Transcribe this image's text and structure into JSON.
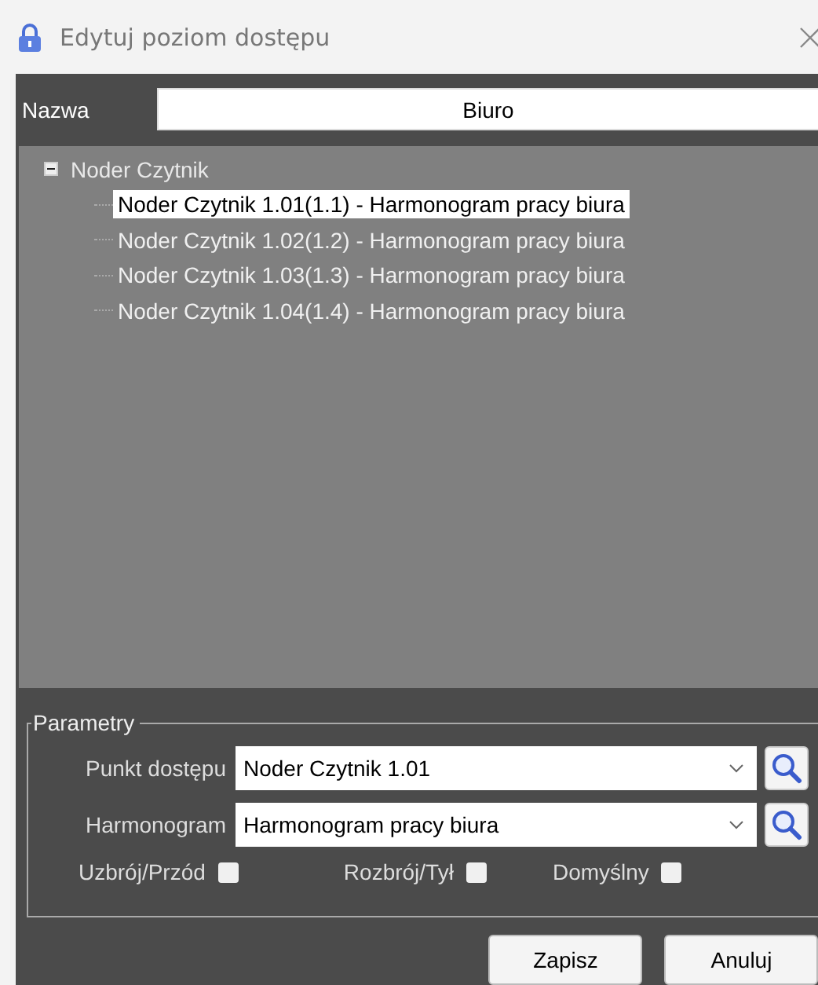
{
  "window": {
    "title": "Edytuj poziom dostępu"
  },
  "name_field": {
    "label": "Nazwa",
    "value": "Biuro"
  },
  "tree": [
    {
      "label": "Noder Czytnik",
      "expanded": true,
      "children": [
        {
          "label": "Noder Czytnik 1.01(1.1) - Harmonogram pracy biura",
          "selected": true
        },
        {
          "label": "Noder Czytnik 1.02(1.2) - Harmonogram pracy biura",
          "selected": false
        },
        {
          "label": "Noder Czytnik 1.03(1.3) - Harmonogram pracy biura",
          "selected": false
        },
        {
          "label": "Noder Czytnik 1.04(1.4) - Harmonogram pracy biura",
          "selected": false
        }
      ]
    }
  ],
  "parameters": {
    "title": "Parametry",
    "fields": [
      {
        "label": "Punkt dostępu",
        "value": "Noder Czytnik 1.01"
      },
      {
        "label": "Harmonogram",
        "value": "Harmonogram pracy biura"
      }
    ],
    "checkboxes": [
      {
        "label": "Uzbrój/Przód",
        "checked": false
      },
      {
        "label": "Rozbrój/Tył",
        "checked": false
      },
      {
        "label": "Domyślny",
        "checked": false
      }
    ]
  },
  "buttons": [
    "Zapisz",
    "Anuluj"
  ]
}
